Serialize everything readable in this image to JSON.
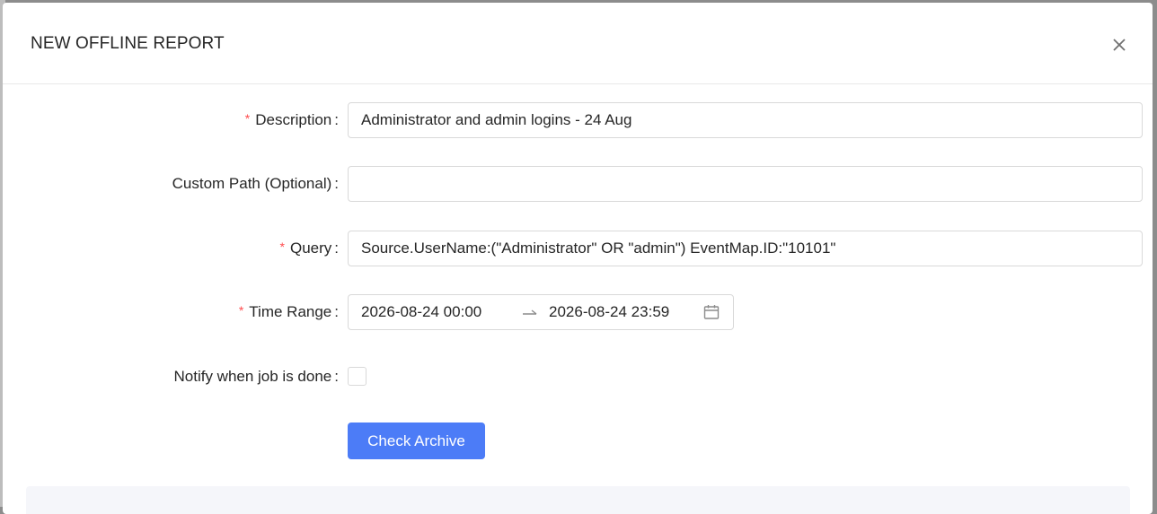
{
  "modal": {
    "title": "NEW OFFLINE REPORT"
  },
  "form": {
    "description": {
      "label": "Description",
      "required": true,
      "value": "Administrator and admin logins - 24 Aug"
    },
    "custom_path": {
      "label": "Custom Path (Optional)",
      "required": false,
      "value": ""
    },
    "query": {
      "label": "Query",
      "required": true,
      "value": "Source.UserName:(\"Administrator\" OR \"admin\") EventMap.ID:\"10101\""
    },
    "time_range": {
      "label": "Time Range",
      "required": true,
      "start": "2026-08-24 00:00",
      "end": "2026-08-24 23:59"
    },
    "notify": {
      "label": "Notify when job is done",
      "checked": false
    },
    "check_archive_label": "Check Archive"
  },
  "colors": {
    "primary": "#4c7cf7",
    "required_mark": "#ff4d4f",
    "border": "#d9d9d9"
  },
  "icons": {
    "close": "close-icon",
    "calendar": "calendar-icon",
    "range_separator": "arrow-right-icon"
  }
}
